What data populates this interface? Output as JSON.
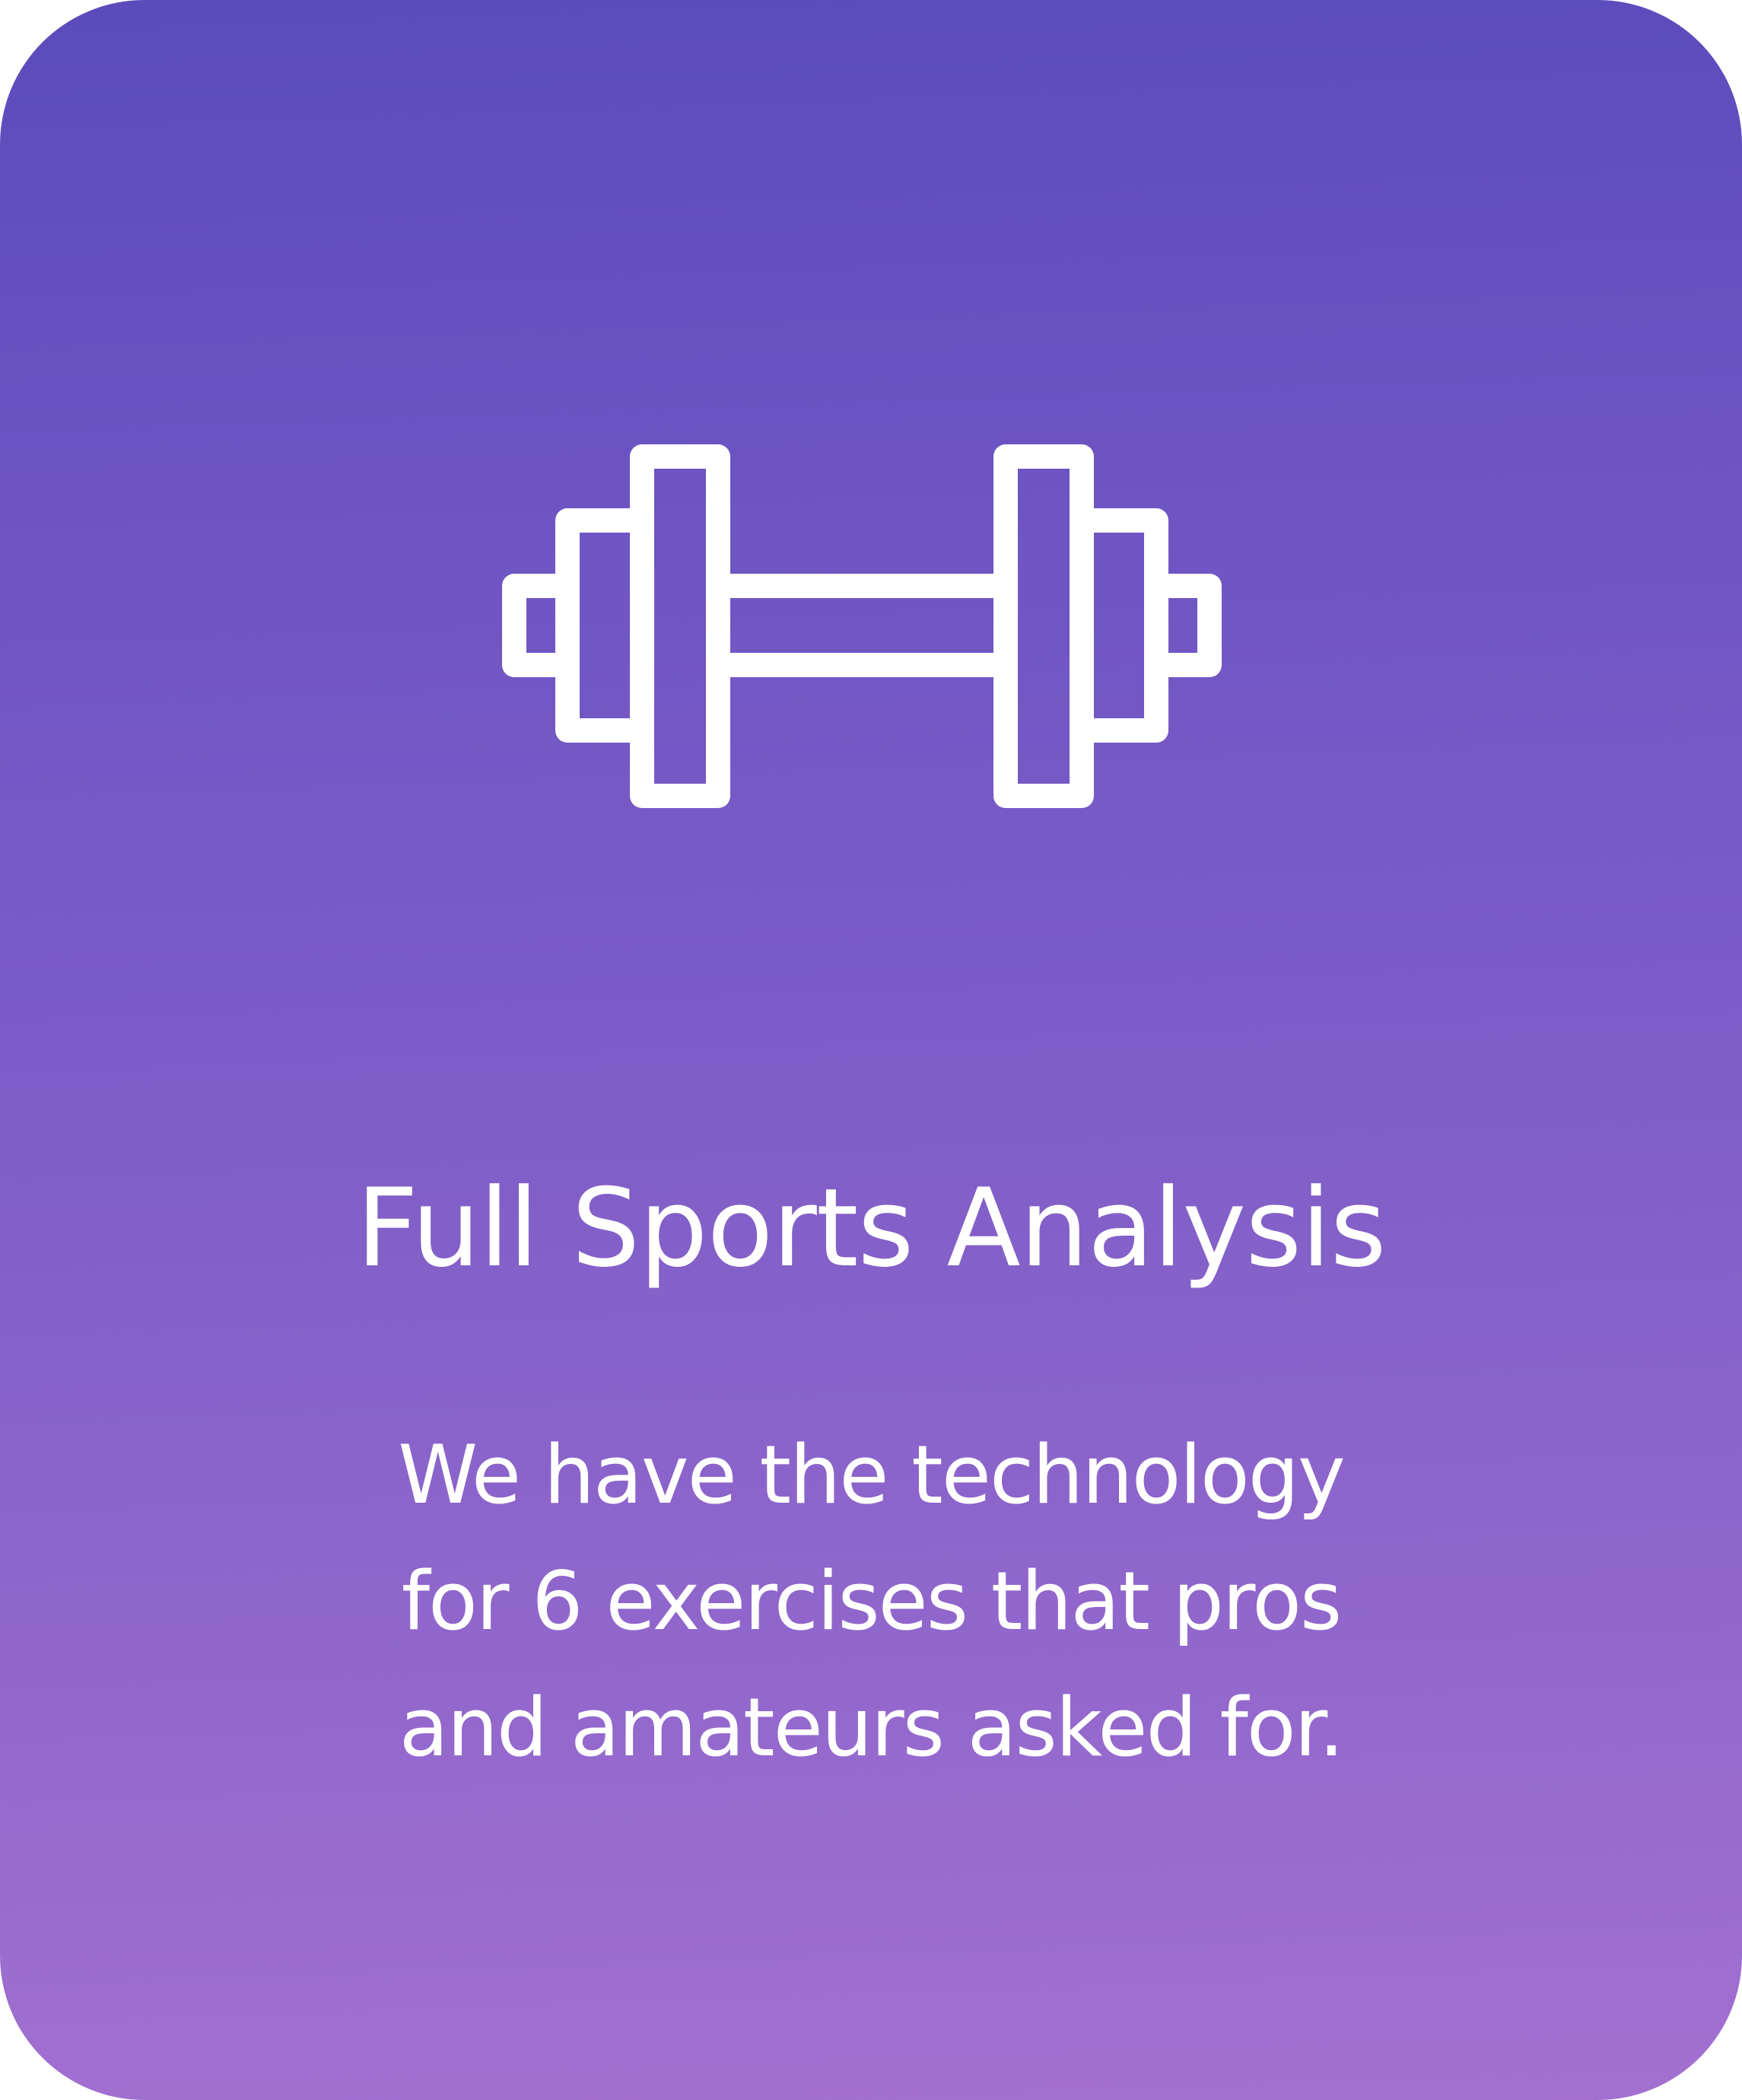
{
  "card": {
    "icon": "dumbbell-icon",
    "title": "Full Sports Analysis",
    "description": "We have the technology\nfor 6 exercises that pros\nand amateurs asked for.",
    "colors": {
      "gradient_top": "#5b4bbb",
      "gradient_bottom": "#a370d1",
      "text": "#ffffff"
    }
  }
}
